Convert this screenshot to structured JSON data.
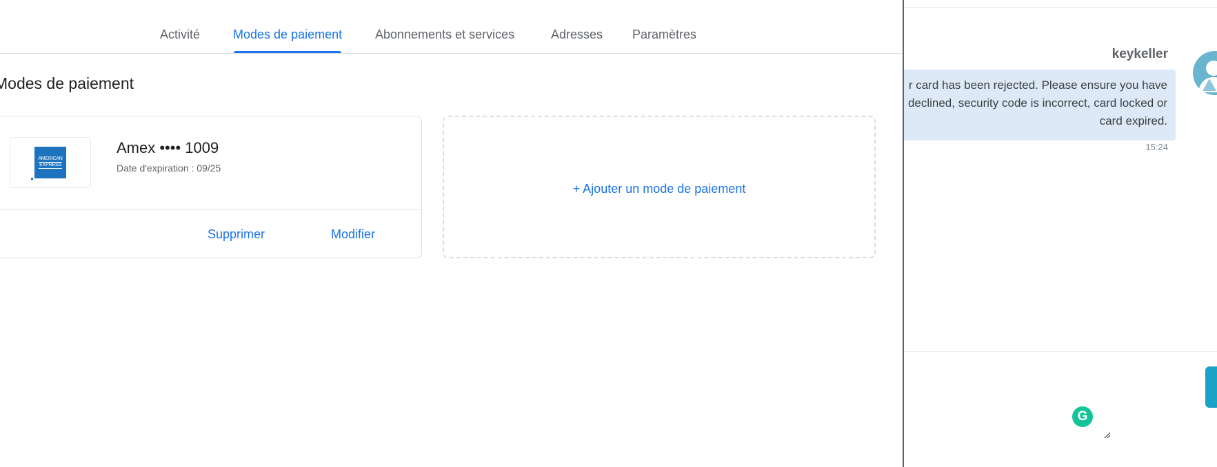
{
  "tabs": [
    {
      "label": "Activité"
    },
    {
      "label": "Modes de paiement"
    },
    {
      "label": "Abonnements et services"
    },
    {
      "label": "Adresses"
    },
    {
      "label": "Paramètres"
    }
  ],
  "active_tab": "Modes de paiement",
  "section_title": "Modes de paiement",
  "card": {
    "logo_text": [
      "AMERICAN",
      "EXPRESS"
    ],
    "name": "Amex •••• 1009",
    "expiry": "Date d'expiration : 09/25",
    "delete_label": "Supprimer",
    "edit_label": "Modifier"
  },
  "add_payment_label": "+  Ajouter un mode de paiement",
  "chat": {
    "sender": "keykeller",
    "message_lines": [
      "r card has been rejected. Please ensure you have",
      "declined, security code is incorrect, card locked or",
      "card expired."
    ],
    "time": "15:24",
    "grammarly_letter": "G"
  },
  "colors": {
    "accent": "#1a73e8",
    "bubble": "#dde9f6",
    "amex_blue": "#1e73be",
    "grammarly": "#15c39a",
    "send_button": "#1aa3c7"
  },
  "icons": {
    "avatar": "user-avatar-icon",
    "grammarly": "grammarly-icon",
    "resize": "resize-handle-icon",
    "send": "send-button"
  }
}
